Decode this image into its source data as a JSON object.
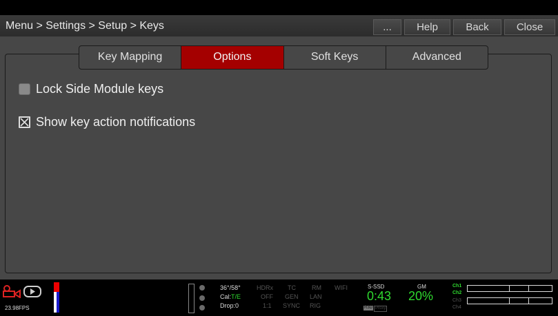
{
  "header": {
    "breadcrumb": "Menu > Settings > Setup > Keys",
    "buttons": [
      {
        "label": "..."
      },
      {
        "label": "Help"
      },
      {
        "label": "Back"
      },
      {
        "label": "Close"
      }
    ]
  },
  "tabs": [
    {
      "label": "Key Mapping",
      "active": false
    },
    {
      "label": "Options",
      "active": true
    },
    {
      "label": "Soft Keys",
      "active": false
    },
    {
      "label": "Advanced",
      "active": false
    }
  ],
  "options": [
    {
      "label": "Lock Side Module keys",
      "checked": false
    },
    {
      "label": "Show key action notifications",
      "checked": true
    }
  ],
  "statusbar": {
    "fps": "23.98FPS",
    "temp": "36°/58°",
    "cal_label": "Cal:",
    "cal_value": "T/E",
    "drop": "Drop:0",
    "hdrx": "HDRx",
    "hdrx_val": "OFF",
    "ratio": "1:1",
    "tc": "TC",
    "gen": "GEN",
    "sync": "SYNC",
    "rm": "RM",
    "lan": "LAN",
    "rig": "RIG",
    "wifi": "WIFI",
    "media_label": "S-SSD",
    "media_time": "0:43",
    "media_badge_1": "R3D",
    "media_badge_2": "Proxy",
    "gm_label": "GM",
    "gm_value": "20%",
    "channels": [
      "Ch1",
      "Ch2",
      "Ch3",
      "Ch4"
    ]
  },
  "colors": {
    "accent_red": "#a40000",
    "status_green": "#2fd92f"
  }
}
